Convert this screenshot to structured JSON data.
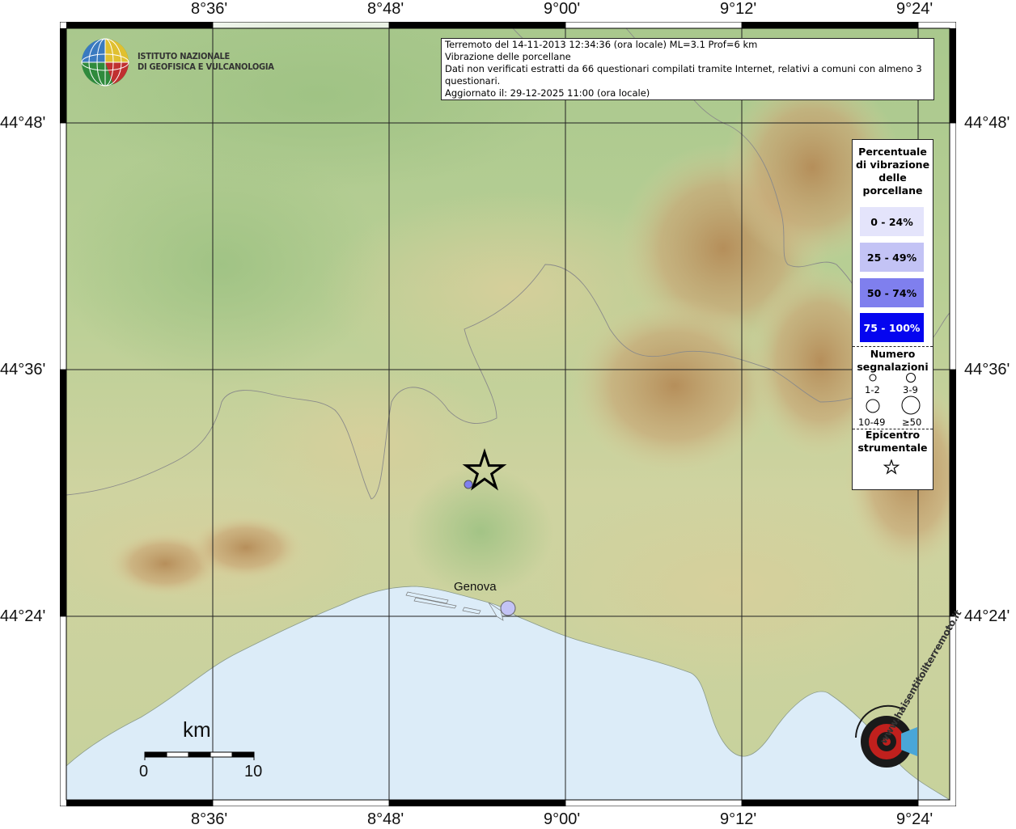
{
  "axes": {
    "longitude_labels": [
      "8°36'",
      "8°48'",
      "9°00'",
      "9°12'",
      "9°24'"
    ],
    "latitude_labels": [
      "44°48'",
      "44°36'",
      "44°24'"
    ]
  },
  "logo": {
    "line1": "ISTITUTO NAZIONALE",
    "line2": "DI GEOFISICA E VULCANOLOGIA"
  },
  "info": {
    "line1": "Terremoto del 14-11-2013 12:34:36 (ora locale) ML=3.1 Prof=6 km",
    "line2": "Vibrazione delle porcellane",
    "line3": "Dati non verificati estratti da 66 questionari compilati tramite Internet, relativi a comuni con almeno 3 questionari.",
    "line4": "Aggiornato il: 29-12-2025 11:00 (ora locale)"
  },
  "legend": {
    "title_lines": [
      "Percentuale",
      "di vibrazione",
      "delle",
      "porcellane"
    ],
    "classes": [
      {
        "label": "0 - 24%",
        "color": "#e4e4fb",
        "text_color": "#000000"
      },
      {
        "label": "25 - 49%",
        "color": "#c3c3f5",
        "text_color": "#000000"
      },
      {
        "label": "50 - 74%",
        "color": "#7f7fee",
        "text_color": "#000000"
      },
      {
        "label": "75 - 100%",
        "color": "#0505f0",
        "text_color": "#ffffff"
      }
    ],
    "count_title_lines": [
      "Numero",
      "segnalazioni"
    ],
    "counts": [
      "1-2",
      "3-9",
      "10-49",
      "≥50"
    ],
    "epicenter_title_lines": [
      "Epicentro",
      "strumentale"
    ]
  },
  "city": {
    "name": "Genova"
  },
  "scale": {
    "unit": "km",
    "start": "0",
    "end": "10"
  },
  "watermark": {
    "text": "www.haisentitoilterremoto.it"
  },
  "colors": {
    "sea": "#dcecf8",
    "lowland": "#a7c78c",
    "hills": "#d8d4a0",
    "mountains": "#b8925f",
    "peaks": "#c9b8a0"
  }
}
